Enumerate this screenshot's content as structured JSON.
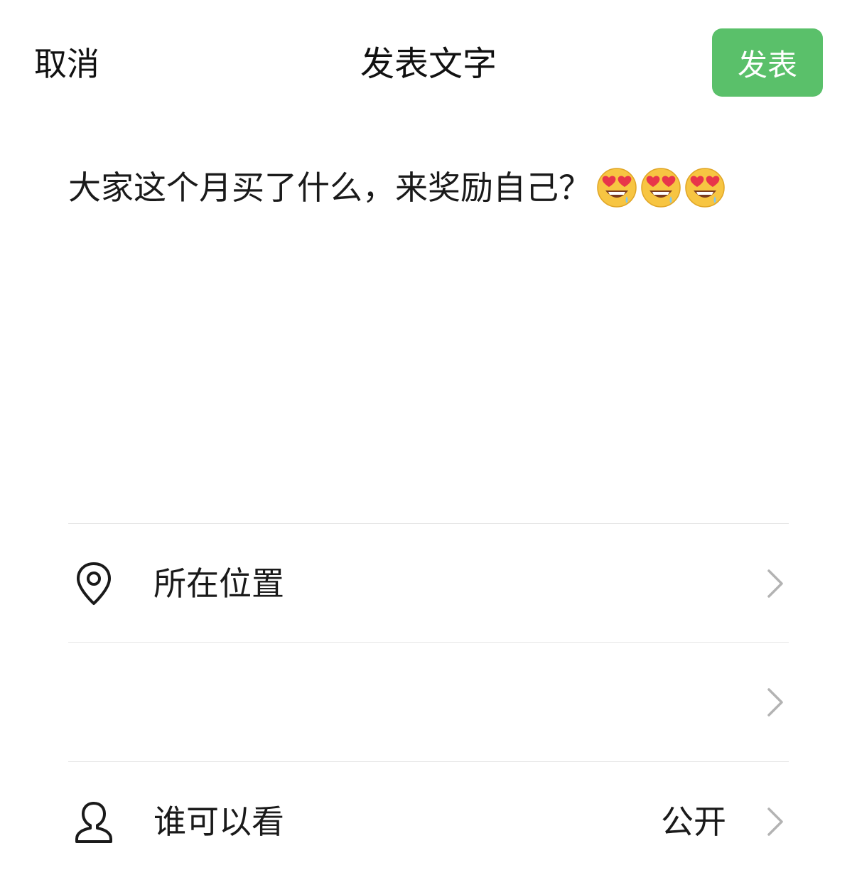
{
  "header": {
    "cancel_label": "取消",
    "title": "发表文字",
    "publish_label": "发表"
  },
  "post": {
    "text": "大家这个月买了什么，来奖励自己？",
    "emojis": [
      "heart-eyes-drooling-emoji",
      "heart-eyes-drooling-emoji",
      "heart-eyes-drooling-emoji"
    ]
  },
  "options": {
    "location": {
      "label": "所在位置",
      "icon": "location-pin-icon"
    },
    "empty_row": {
      "label": ""
    },
    "visibility": {
      "label": "谁可以看",
      "value": "公开",
      "icon": "person-icon"
    }
  },
  "colors": {
    "accent": "#5ac06a",
    "divider": "#e6e6e6",
    "chevron": "#b3b3b3"
  }
}
